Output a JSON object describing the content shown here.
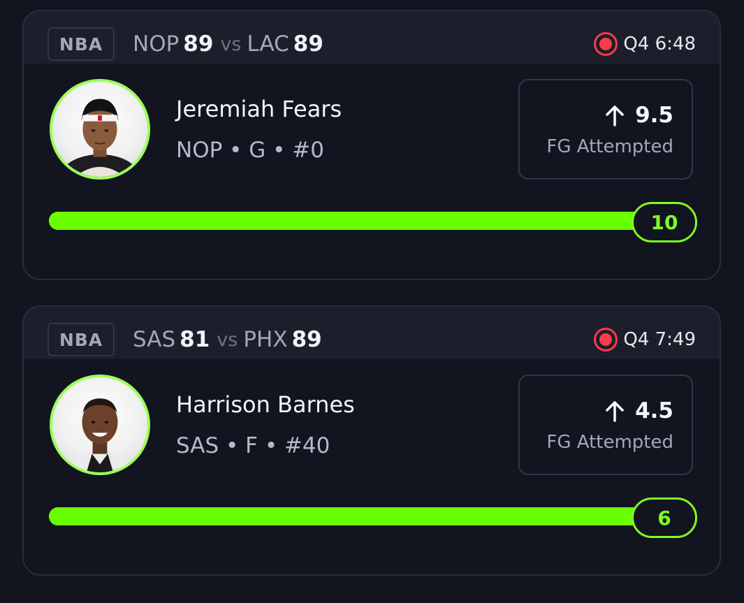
{
  "cards": [
    {
      "league": "NBA",
      "home_team": "NOP",
      "home_score": "89",
      "vs": "vs",
      "away_team": "LAC",
      "away_score": "89",
      "game_clock": "Q4 6:48",
      "player_name": "Jeremiah Fears",
      "player_meta": "NOP • G • #0",
      "line": "9.5",
      "direction_icon": "arrow-up-icon",
      "stat": "FG Attempted",
      "current_value": "10",
      "progress": 1.0
    },
    {
      "league": "NBA",
      "home_team": "SAS",
      "home_score": "81",
      "vs": "vs",
      "away_team": "PHX",
      "away_score": "89",
      "game_clock": "Q4 7:49",
      "player_name": "Harrison Barnes",
      "player_meta": "SAS • F • #40",
      "line": "4.5",
      "direction_icon": "arrow-up-icon",
      "stat": "FG Attempted",
      "current_value": "6",
      "progress": 1.0
    }
  ],
  "colors": {
    "background": "#12141f",
    "header": "#1c1e2b",
    "accent_green": "#6aff00",
    "live_red": "#ff3b4a"
  }
}
